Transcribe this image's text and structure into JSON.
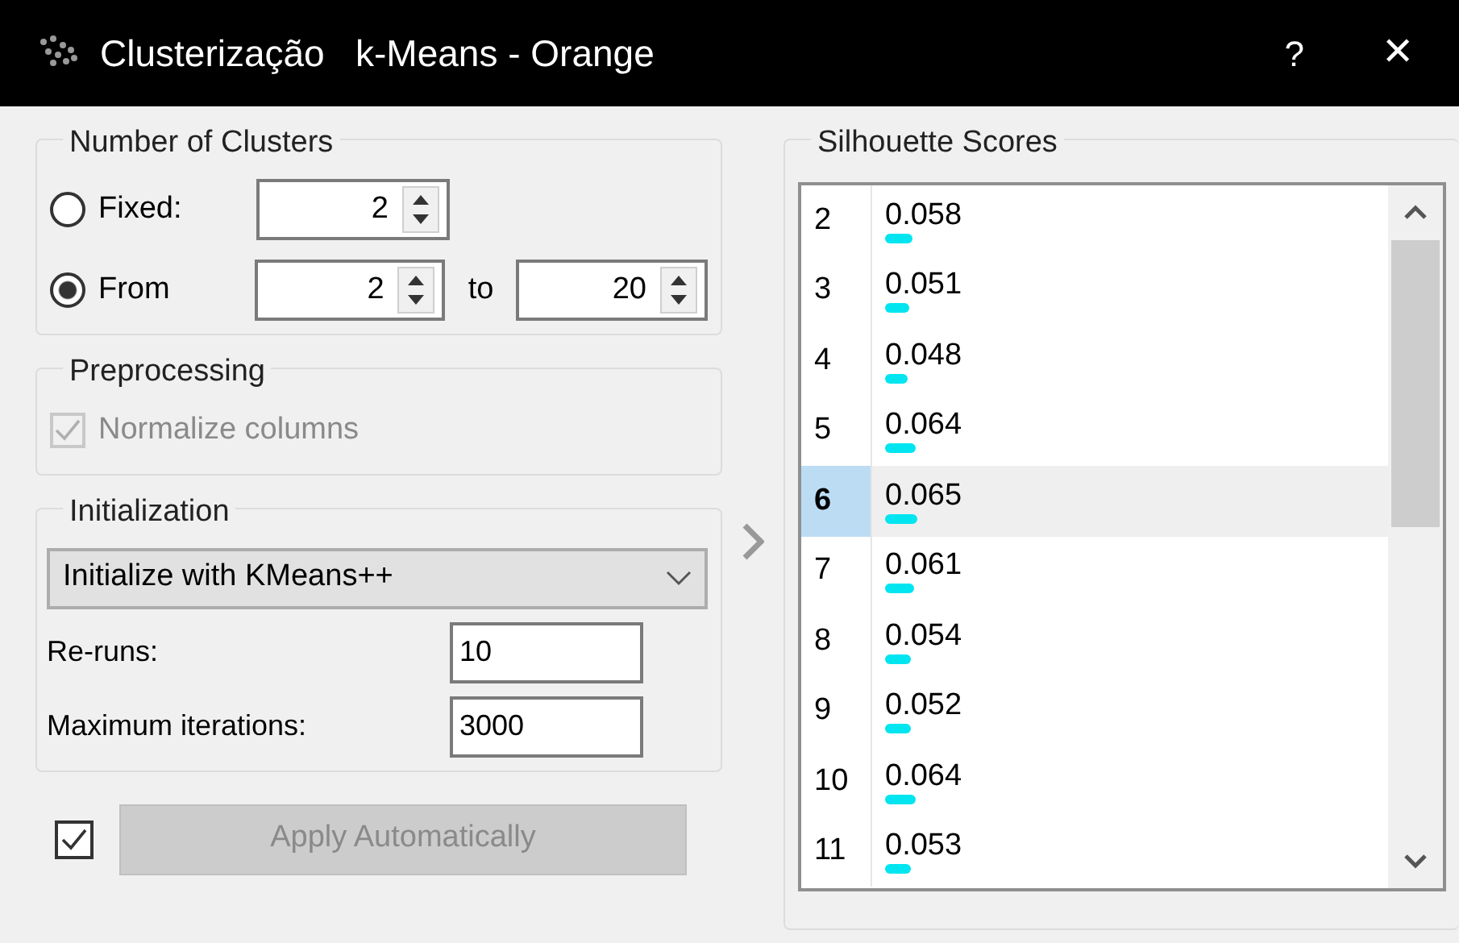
{
  "window": {
    "title": "Clusterização   k-Means - Orange",
    "help": "?",
    "close": "✕"
  },
  "number_of_clusters": {
    "title": "Number of Clusters",
    "options": [
      {
        "label": "Fixed:",
        "selected": false,
        "fields": [
          {
            "value": "2"
          }
        ]
      },
      {
        "label": "From",
        "selected": true,
        "fields": [
          {
            "value": "2"
          },
          {
            "connector": "to",
            "value": "20"
          }
        ]
      }
    ]
  },
  "preprocessing": {
    "title": "Preprocessing",
    "normalize": {
      "label": "Normalize columns",
      "checked": true,
      "disabled": true
    }
  },
  "initialization": {
    "title": "Initialization",
    "method": "Initialize with KMeans++",
    "reruns": {
      "label": "Re-runs:",
      "value": "10"
    },
    "max_iterations": {
      "label": "Maximum iterations:",
      "value": "3000"
    }
  },
  "apply": {
    "checked": true,
    "label": "Apply Automatically",
    "disabled": true
  },
  "silhouette": {
    "title": "Silhouette Scores",
    "rows": [
      {
        "k": "2",
        "score": "0.058",
        "selected": false
      },
      {
        "k": "3",
        "score": "0.051",
        "selected": false
      },
      {
        "k": "4",
        "score": "0.048",
        "selected": false
      },
      {
        "k": "5",
        "score": "0.064",
        "selected": false
      },
      {
        "k": "6",
        "score": "0.065",
        "selected": true
      },
      {
        "k": "7",
        "score": "0.061",
        "selected": false
      },
      {
        "k": "8",
        "score": "0.054",
        "selected": false
      },
      {
        "k": "9",
        "score": "0.052",
        "selected": false
      },
      {
        "k": "10",
        "score": "0.064",
        "selected": false
      },
      {
        "k": "11",
        "score": "0.053",
        "selected": false
      }
    ]
  }
}
